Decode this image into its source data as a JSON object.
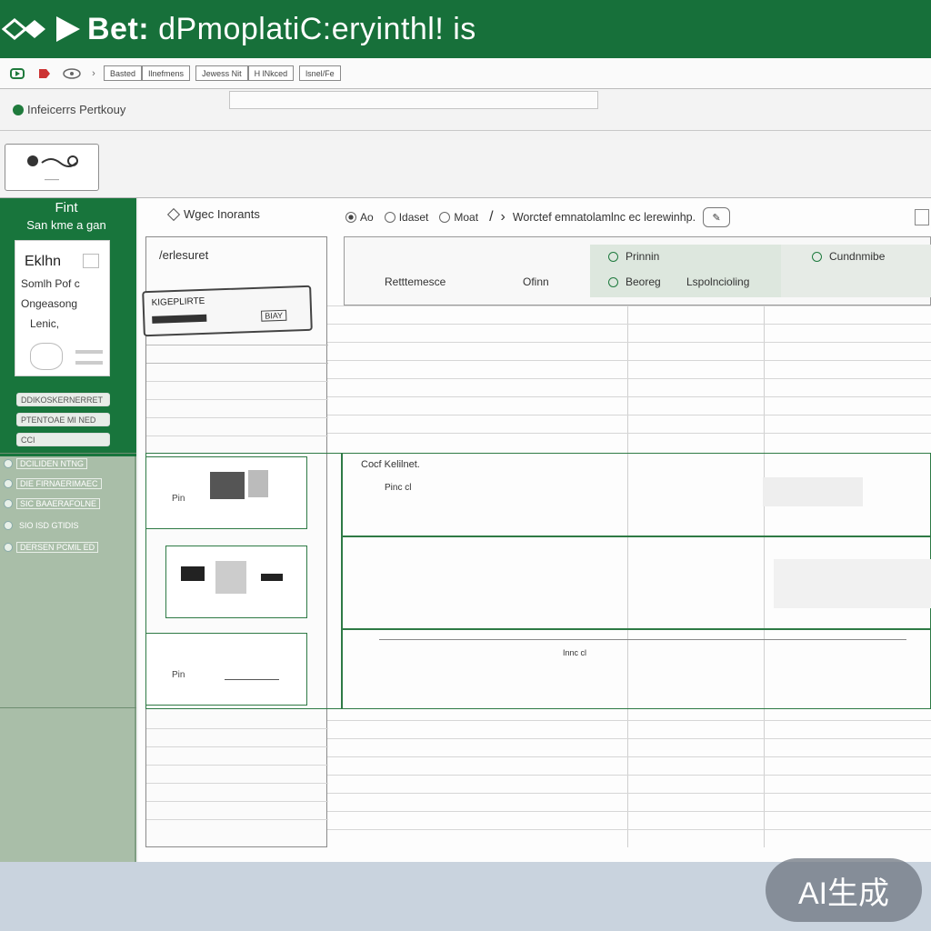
{
  "window": {
    "title_bold": "Bet:",
    "title_rest": "dPmoplatiC:eryinthl! is"
  },
  "toolbar": {
    "buttons": [
      "Basted",
      "Ilnefmens",
      "Jewess Nit",
      "H lNkced",
      "lsnel/Fe"
    ]
  },
  "path": {
    "label": "Infeicerrs Pertkouy"
  },
  "sidebar": {
    "title": "Fint",
    "subtitle": "San kme a gan",
    "card": {
      "heading": "Eklhn",
      "lines": [
        "Somlh Pof c",
        "Ongeasong",
        "Lenic,"
      ]
    },
    "pills": [
      "DDIKOSKERNERRET",
      "PTENTOAE MI NED",
      "CCI"
    ],
    "rows": [
      "DCILIDEN NTNG",
      "DIE FIRNAERIMAEC",
      "SIC BAAERAFOLNE",
      "SIO ISD GTIDIS",
      "DERSEN PCMIL ED"
    ]
  },
  "main": {
    "tab_label": "Wgec Inorants",
    "radios": [
      "Ao",
      "Idaset",
      "Moat"
    ],
    "long_label": "Worctef emnatolamlnc ec lerewinhp.",
    "left_heading": "/erlesuret",
    "tag_label": "KIGEPLIRTE",
    "tag_small": "BIAY",
    "top_cells": {
      "left_label": "Retttemesce",
      "mid_label": "Ofinn",
      "radio_a": "Prinnin",
      "radio_b": "Beoreg",
      "radio_c": "Cundnmibe",
      "mid_b": "Lspolncioling"
    },
    "rows": [
      {
        "label": "Cocf Kelilnet.",
        "sub": "Pinc cl",
        "card_label": "Pin"
      },
      {
        "label": "",
        "sub": "",
        "card_label": ""
      },
      {
        "label": "",
        "sub": "Innc cl",
        "card_label": "Pin"
      }
    ]
  },
  "watermark": "AI生成"
}
